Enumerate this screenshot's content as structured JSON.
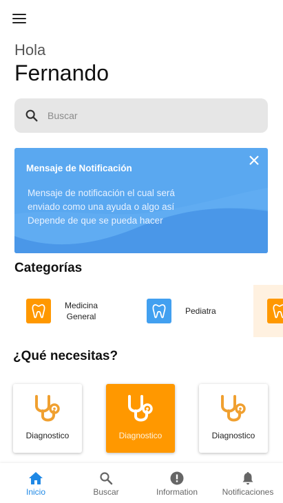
{
  "header": {
    "greeting": "Hola",
    "username": "Fernando"
  },
  "search": {
    "placeholder": "Buscar"
  },
  "notification": {
    "title": "Mensaje de Notificación",
    "line1": "Mensaje de notificación el cual será",
    "line2": "enviado como una ayuda o algo así",
    "line3": "Depende de que se pueda hacer"
  },
  "categories": {
    "title": "Categorías",
    "items": [
      {
        "line1": "Medicina",
        "line2": "General",
        "icon": "tooth-icon"
      },
      {
        "line1": "Pediatra",
        "icon": "tooth-icon"
      },
      {
        "line1": "",
        "icon": "tooth-icon"
      }
    ]
  },
  "needs": {
    "title": "¿Qué necesitas?",
    "cards": [
      {
        "label": "Diagnostico",
        "icon": "stethoscope-icon"
      },
      {
        "label": "Diagnostico",
        "icon": "stethoscope-icon",
        "selected": true
      },
      {
        "label": "Diagnostico",
        "icon": "stethoscope-icon"
      }
    ]
  },
  "nav": {
    "items": [
      {
        "label": "Inicio",
        "icon": "home-icon",
        "active": true
      },
      {
        "label": "Buscar",
        "icon": "search-icon"
      },
      {
        "label": "Information",
        "icon": "info-icon"
      },
      {
        "label": "Notificaciones",
        "icon": "bell-icon"
      }
    ]
  },
  "colors": {
    "accent_orange": "#ff9800",
    "accent_blue": "#1e88e5",
    "notification_blue": "#5aa8f0",
    "category_blue": "#42a0f0"
  }
}
